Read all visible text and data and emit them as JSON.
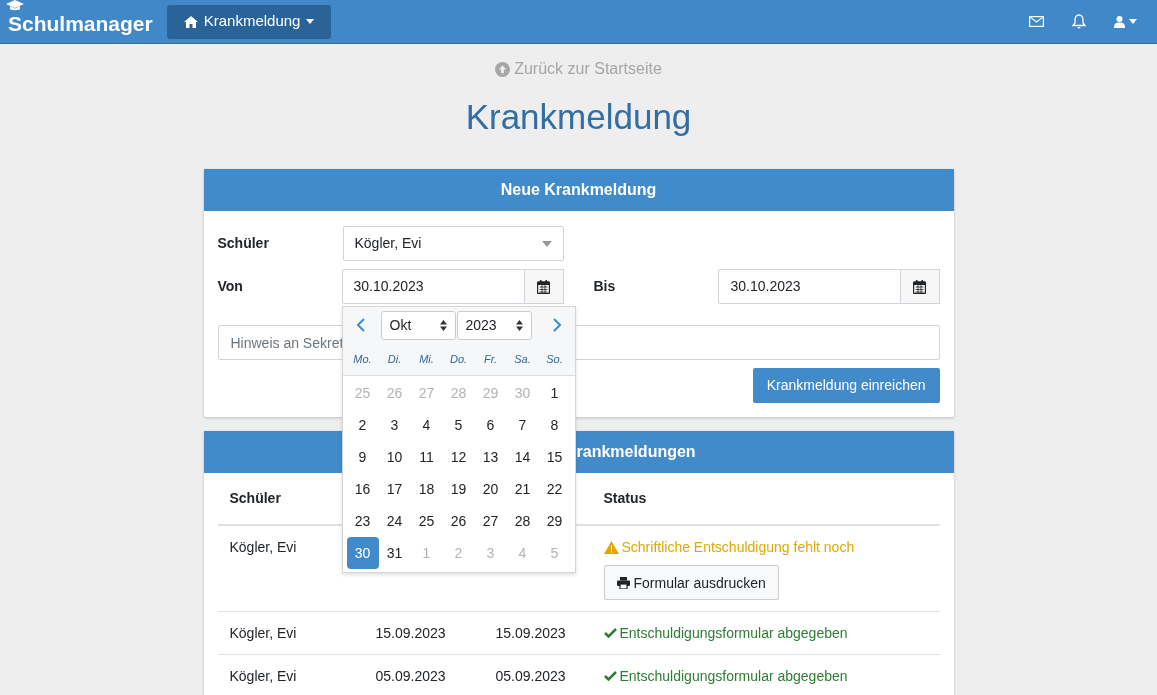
{
  "navbar": {
    "brand": "Schulmanager",
    "menu": {
      "label": "Krankmeldung"
    }
  },
  "back_link": "Zurück zur Startseite",
  "title": "Krankmeldung",
  "form_card": {
    "title": "Neue Krankmeldung",
    "student": {
      "label": "Schüler",
      "value": "Kögler, Evi"
    },
    "from": {
      "label": "Von",
      "value": "30.10.2023"
    },
    "to": {
      "label": "Bis",
      "value": "30.10.2023"
    },
    "note": {
      "placeholder": "Hinweis an Sekret"
    },
    "submit": "Krankmeldung einreichen"
  },
  "datepicker": {
    "month": "Okt",
    "year": "2023",
    "weekdays": [
      "Mo.",
      "Di.",
      "Mi.",
      "Do.",
      "Fr.",
      "Sa.",
      "So."
    ],
    "days": [
      {
        "label": "25",
        "outside": true,
        "selected": false
      },
      {
        "label": "26",
        "outside": true,
        "selected": false
      },
      {
        "label": "27",
        "outside": true,
        "selected": false
      },
      {
        "label": "28",
        "outside": true,
        "selected": false
      },
      {
        "label": "29",
        "outside": true,
        "selected": false
      },
      {
        "label": "30",
        "outside": true,
        "selected": false
      },
      {
        "label": "1",
        "outside": false,
        "selected": false
      },
      {
        "label": "2",
        "outside": false,
        "selected": false
      },
      {
        "label": "3",
        "outside": false,
        "selected": false
      },
      {
        "label": "4",
        "outside": false,
        "selected": false
      },
      {
        "label": "5",
        "outside": false,
        "selected": false
      },
      {
        "label": "6",
        "outside": false,
        "selected": false
      },
      {
        "label": "7",
        "outside": false,
        "selected": false
      },
      {
        "label": "8",
        "outside": false,
        "selected": false
      },
      {
        "label": "9",
        "outside": false,
        "selected": false
      },
      {
        "label": "10",
        "outside": false,
        "selected": false
      },
      {
        "label": "11",
        "outside": false,
        "selected": false
      },
      {
        "label": "12",
        "outside": false,
        "selected": false
      },
      {
        "label": "13",
        "outside": false,
        "selected": false
      },
      {
        "label": "14",
        "outside": false,
        "selected": false
      },
      {
        "label": "15",
        "outside": false,
        "selected": false
      },
      {
        "label": "16",
        "outside": false,
        "selected": false
      },
      {
        "label": "17",
        "outside": false,
        "selected": false
      },
      {
        "label": "18",
        "outside": false,
        "selected": false
      },
      {
        "label": "19",
        "outside": false,
        "selected": false
      },
      {
        "label": "20",
        "outside": false,
        "selected": false
      },
      {
        "label": "21",
        "outside": false,
        "selected": false
      },
      {
        "label": "22",
        "outside": false,
        "selected": false
      },
      {
        "label": "23",
        "outside": false,
        "selected": false
      },
      {
        "label": "24",
        "outside": false,
        "selected": false
      },
      {
        "label": "25",
        "outside": false,
        "selected": false
      },
      {
        "label": "26",
        "outside": false,
        "selected": false
      },
      {
        "label": "27",
        "outside": false,
        "selected": false
      },
      {
        "label": "28",
        "outside": false,
        "selected": false
      },
      {
        "label": "29",
        "outside": false,
        "selected": false
      },
      {
        "label": "30",
        "outside": false,
        "selected": true
      },
      {
        "label": "31",
        "outside": false,
        "selected": false
      },
      {
        "label": "1",
        "outside": true,
        "selected": false
      },
      {
        "label": "2",
        "outside": true,
        "selected": false
      },
      {
        "label": "3",
        "outside": true,
        "selected": false
      },
      {
        "label": "4",
        "outside": true,
        "selected": false
      },
      {
        "label": "5",
        "outside": true,
        "selected": false
      }
    ]
  },
  "list_card": {
    "title": "rankmeldungen",
    "columns": [
      "Schüler",
      "Status"
    ],
    "rows": [
      {
        "student": "Kögler, Evi",
        "status": {
          "kind": "warning",
          "text": "Schriftliche Entschuldigung fehlt noch"
        },
        "action": "Formular ausdrucken"
      },
      {
        "student": "Kögler, Evi",
        "from": "15.09.2023",
        "to": "15.09.2023",
        "status": {
          "kind": "ok",
          "text": "Entschuldigungsformular abgegeben"
        }
      },
      {
        "student": "Kögler, Evi",
        "from": "05.09.2023",
        "to": "05.09.2023",
        "status": {
          "kind": "ok",
          "text": "Entschuldigungsformular abgegeben"
        }
      }
    ]
  }
}
